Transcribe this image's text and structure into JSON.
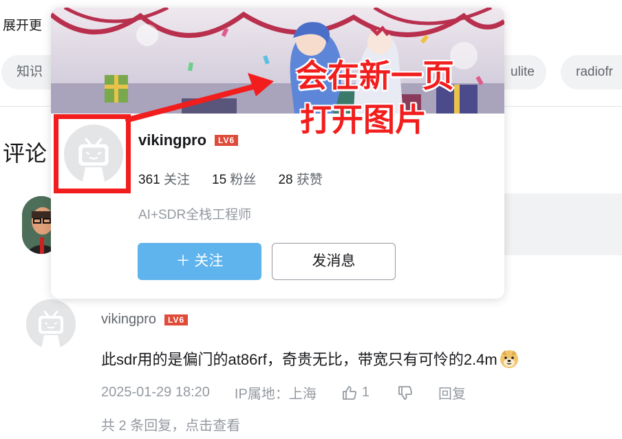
{
  "page": {
    "expand_text": "展开更",
    "tags": [
      "知识",
      "ulite",
      "radiofr"
    ],
    "comment_heading": "评论"
  },
  "reply": {
    "username": "vikingpro",
    "level": "LV6",
    "text": "此sdr用的是偏门的at86rf，奇贵无比，带宽只有可怜的2.4m",
    "emoji": "doge-emoji",
    "time": "2025-01-29 18:20",
    "ip_location": "IP属地：上海",
    "likes": "1",
    "reply_label": "回复",
    "replies_summary": "共 2 条回复，点击查看"
  },
  "card": {
    "username": "vikingpro",
    "level": "LV6",
    "stats": [
      {
        "num": "361",
        "label": "关注"
      },
      {
        "num": "15",
        "label": "粉丝"
      },
      {
        "num": "28",
        "label": "获赞"
      }
    ],
    "bio": "AI+SDR全栈工程师",
    "follow_label": "＋ 关注",
    "message_label": "发消息"
  },
  "annotation": {
    "line1": "会在新一页",
    "line2": "打开图片"
  },
  "colors": {
    "accent": "#5fb4ed",
    "annotation": "#f21d1d",
    "level_badge": "#e04a38",
    "muted": "#9499a0"
  },
  "icons": [
    "bilibili-tv-avatar-icon",
    "thumbs-up-icon",
    "thumbs-down-icon",
    "doge-emoji"
  ]
}
